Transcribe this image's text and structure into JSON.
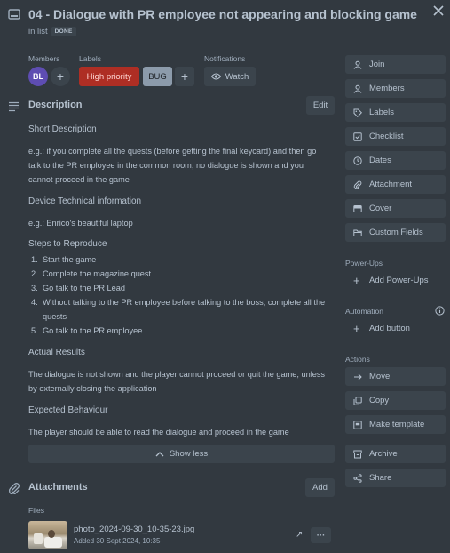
{
  "header": {
    "title": "04 - Dialogue with PR employee not appearing and blocking game",
    "in_list": "in list",
    "list_badge": "DONE"
  },
  "members": {
    "label": "Members",
    "avatar_initials": "BL",
    "avatar_color": "#5e4db2"
  },
  "labels": {
    "label": "Labels",
    "items": [
      {
        "text": "High priority",
        "color": "#ae2e24"
      },
      {
        "text": "BUG",
        "color": "#8c9bab"
      }
    ]
  },
  "notifications": {
    "label": "Notifications",
    "watch": "Watch"
  },
  "description": {
    "heading": "Description",
    "edit": "Edit",
    "short_desc_heading": "Short Description",
    "short_desc_lines": [
      "e.g.: if you complete all the quests (before getting the final keycard) and then go",
      "talk to the PR employee in the common room, no dialogue is shown and you",
      "cannot proceed in the game"
    ],
    "device_heading": "Device Technical information",
    "device_text": "e.g.: Enrico's beautiful laptop",
    "steps_heading": "Steps to Reproduce",
    "steps": [
      {
        "num": "1.",
        "lines": [
          "Start the game"
        ]
      },
      {
        "num": "2.",
        "lines": [
          "Complete the magazine quest"
        ]
      },
      {
        "num": "3.",
        "lines": [
          "Go talk to the PR Lead"
        ]
      },
      {
        "num": "4.",
        "lines": [
          "Without talking to the PR employee before talking to the boss, complete all the",
          "quests"
        ]
      },
      {
        "num": "5.",
        "lines": [
          "Go talk to the PR employee"
        ]
      }
    ],
    "actual_heading": "Actual Results",
    "actual_lines": [
      "The dialogue is not shown and the player cannot proceed or quit the game, unless",
      "by externally closing the application"
    ],
    "expected_heading": "Expected Behaviour",
    "expected_text": "The player should be able to read the dialogue and proceed in the game",
    "show_less": "Show less"
  },
  "attachments": {
    "heading": "Attachments",
    "add": "Add",
    "files_label": "Files",
    "file_name": "photo_2024-09-30_10-35-23.jpg",
    "file_added": "Added 30 Sept 2024, 10:35",
    "more": "···",
    "open_icon": "↗"
  },
  "sidebar": {
    "buttons": [
      {
        "label": "Join",
        "icon": "person-icon"
      },
      {
        "label": "Members",
        "icon": "person-icon"
      },
      {
        "label": "Labels",
        "icon": "tag-icon"
      },
      {
        "label": "Checklist",
        "icon": "checkbox-icon"
      },
      {
        "label": "Dates",
        "icon": "clock-icon"
      },
      {
        "label": "Attachment",
        "icon": "paperclip-icon"
      },
      {
        "label": "Cover",
        "icon": "cover-icon"
      },
      {
        "label": "Custom Fields",
        "icon": "folder-icon"
      }
    ],
    "powerups_heading": "Power-Ups",
    "add_powerups": "Add Power-Ups",
    "automation_heading": "Automation",
    "add_button": "Add button",
    "actions_heading": "Actions",
    "actions": [
      {
        "label": "Move",
        "icon": "arrow-right-icon"
      },
      {
        "label": "Copy",
        "icon": "copy-icon"
      },
      {
        "label": "Make template",
        "icon": "template-icon"
      },
      {
        "label": "Archive",
        "icon": "archive-icon"
      },
      {
        "label": "Share",
        "icon": "share-icon"
      }
    ]
  }
}
